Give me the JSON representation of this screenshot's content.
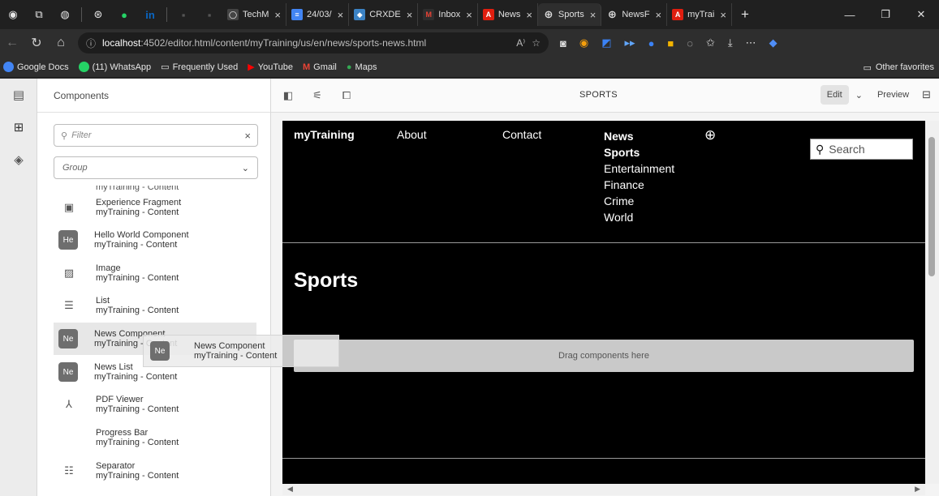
{
  "browser": {
    "tabs": [
      {
        "label": "TechM",
        "active": false
      },
      {
        "label": "24/03/",
        "active": false
      },
      {
        "label": "CRXDE",
        "active": false
      },
      {
        "label": "Inbox",
        "active": false
      },
      {
        "label": "News",
        "active": false
      },
      {
        "label": "Sports",
        "active": true
      },
      {
        "label": "NewsF",
        "active": false
      },
      {
        "label": "myTrai",
        "active": false
      }
    ],
    "url_host": "localhost",
    "url_path": ":4502/editor.html/content/myTraining/us/en/news/sports-news.html",
    "bookmarks": [
      "Google Docs",
      "(11) WhatsApp",
      "Frequently Used",
      "YouTube",
      "Gmail",
      "Maps"
    ],
    "other_favorites": "Other favorites"
  },
  "editor": {
    "panel_title": "Components",
    "filter_placeholder": "Filter",
    "group_label": "Group",
    "partial_item": "myTraining - Content",
    "components": [
      {
        "name": "Experience Fragment",
        "group": "myTraining - Content",
        "icon": "fragment-icon"
      },
      {
        "name": "Hello World Component",
        "group": "myTraining - Content",
        "badge": "He"
      },
      {
        "name": "Image",
        "group": "myTraining - Content",
        "icon": "image-icon"
      },
      {
        "name": "List",
        "group": "myTraining - Content",
        "icon": "list-icon"
      },
      {
        "name": "News Component",
        "group": "myTraining - Content",
        "badge": "Ne"
      },
      {
        "name": "News List",
        "group": "myTraining - Content",
        "badge": "Ne"
      },
      {
        "name": "PDF Viewer",
        "group": "myTraining - Content",
        "icon": "pdf-icon"
      },
      {
        "name": "Progress Bar",
        "group": "myTraining - Content"
      },
      {
        "name": "Separator",
        "group": "myTraining - Content",
        "icon": "separator-icon"
      }
    ],
    "drag_ghost": {
      "badge": "Ne",
      "name": "News Component",
      "group": "myTraining - Content"
    },
    "page_name": "SPORTS",
    "mode": "Edit",
    "preview": "Preview"
  },
  "site": {
    "logo": "myTraining",
    "nav_about": "About",
    "nav_contact": "Contact",
    "nav_news": "News",
    "nav_sports": "Sports",
    "nav_entertainment": "Entertainment",
    "nav_finance": "Finance",
    "nav_crime": "Crime",
    "nav_world": "World",
    "search_placeholder": "Search",
    "title": "Sports",
    "dropzone": "Drag components here"
  }
}
